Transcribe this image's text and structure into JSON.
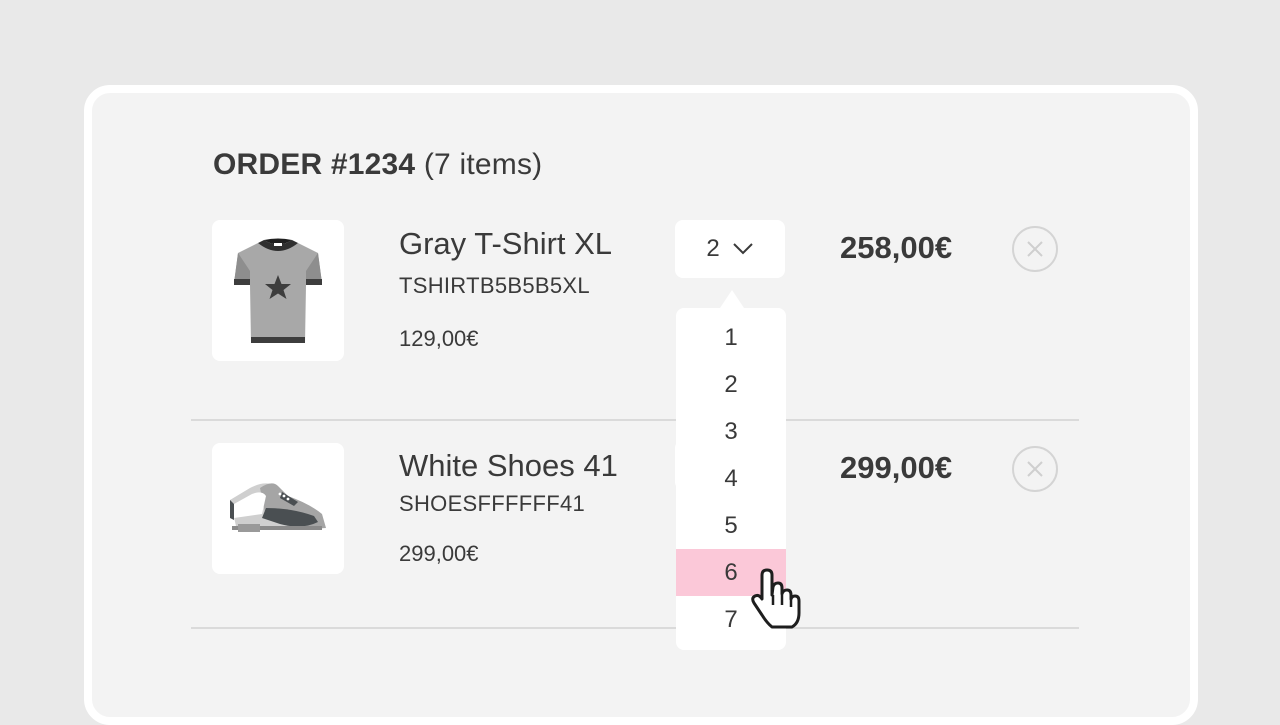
{
  "order": {
    "title_bold": "ORDER #1234",
    "title_rest": "(7 items)"
  },
  "items": [
    {
      "name": "Gray T-Shirt XL",
      "sku": "TSHIRTB5B5B5XL",
      "unit_price": "129,00€",
      "quantity": "2",
      "total": "258,00€",
      "icon": "tshirt-icon"
    },
    {
      "name": "White Shoes 41",
      "sku": "SHOESFFFFFF41",
      "unit_price": "299,00€",
      "total": "299,00€",
      "icon": "shoes-icon"
    }
  ],
  "quantity_dropdown": {
    "options": [
      "1",
      "2",
      "3",
      "4",
      "5",
      "6",
      "7"
    ],
    "hovered": "6"
  },
  "colors": {
    "hover": "#fbc8d8",
    "background": "#e9e9e9",
    "card": "#f3f3f3"
  }
}
